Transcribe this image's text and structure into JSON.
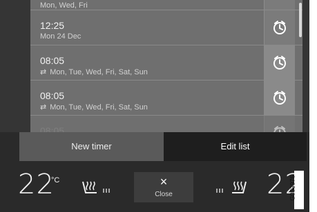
{
  "timers": [
    {
      "time": "",
      "days": "Mon, Wed, Fri",
      "repeat": false
    },
    {
      "time": "12:25",
      "days": "Mon 24 Dec",
      "repeat": false
    },
    {
      "time": "08:05",
      "days": "Mon, Tue, Wed, Fri, Sat, Sun",
      "repeat": true
    },
    {
      "time": "08:05",
      "days": "Mon, Tue, Wed, Fri, Sat, Sun",
      "repeat": true
    },
    {
      "time": "08:05",
      "days": "",
      "repeat": false
    }
  ],
  "actions": {
    "new_timer": "New timer",
    "edit_list": "Edit list"
  },
  "climate": {
    "left_temp": "22",
    "unit": "°C",
    "right_temp": "22",
    "close_label": "Close",
    "close_icon": "×"
  },
  "figure_code": "G053976",
  "icons": {
    "timer": "timer-icon",
    "repeat": "repeat-icon",
    "seat_heat": "seat-heat-icon"
  },
  "colors": {
    "screen_bg": "#2a2a2a",
    "list_bg": "#6f6f6f",
    "edit_list_bg": "#1e1e1e"
  }
}
